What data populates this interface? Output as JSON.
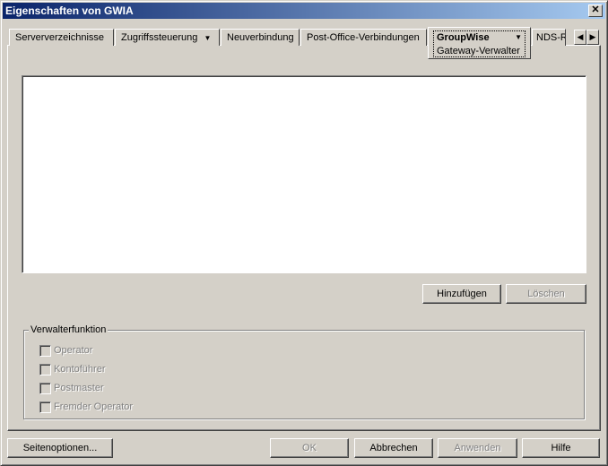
{
  "window": {
    "title": "Eigenschaften von GWIA",
    "close": "✕"
  },
  "tabs": [
    {
      "label": "Serververzeichnisse"
    },
    {
      "label": "Zugriffssteuerung",
      "dropdown": "▼"
    },
    {
      "label": "Neuverbindung"
    },
    {
      "label": "Post-Office-Verbindungen"
    },
    {
      "label": "GroupWise",
      "dropdown": "▼",
      "subtab": "Gateway-Verwalter"
    },
    {
      "label": "NDS-R"
    }
  ],
  "tab_scroll": {
    "left": "◀",
    "right": "▶"
  },
  "list_buttons": {
    "add": "Hinzufügen",
    "delete": "Löschen"
  },
  "group": {
    "title": "Verwalterfunktion",
    "checkboxes": [
      {
        "label": "Operator",
        "checked": false
      },
      {
        "label": "Kontoführer",
        "checked": false
      },
      {
        "label": "Postmaster",
        "checked": false
      },
      {
        "label": "Fremder Operator",
        "checked": false
      }
    ]
  },
  "footer": {
    "page_options": "Seitenoptionen...",
    "ok": "OK",
    "cancel": "Abbrechen",
    "apply": "Anwenden",
    "help": "Hilfe"
  }
}
